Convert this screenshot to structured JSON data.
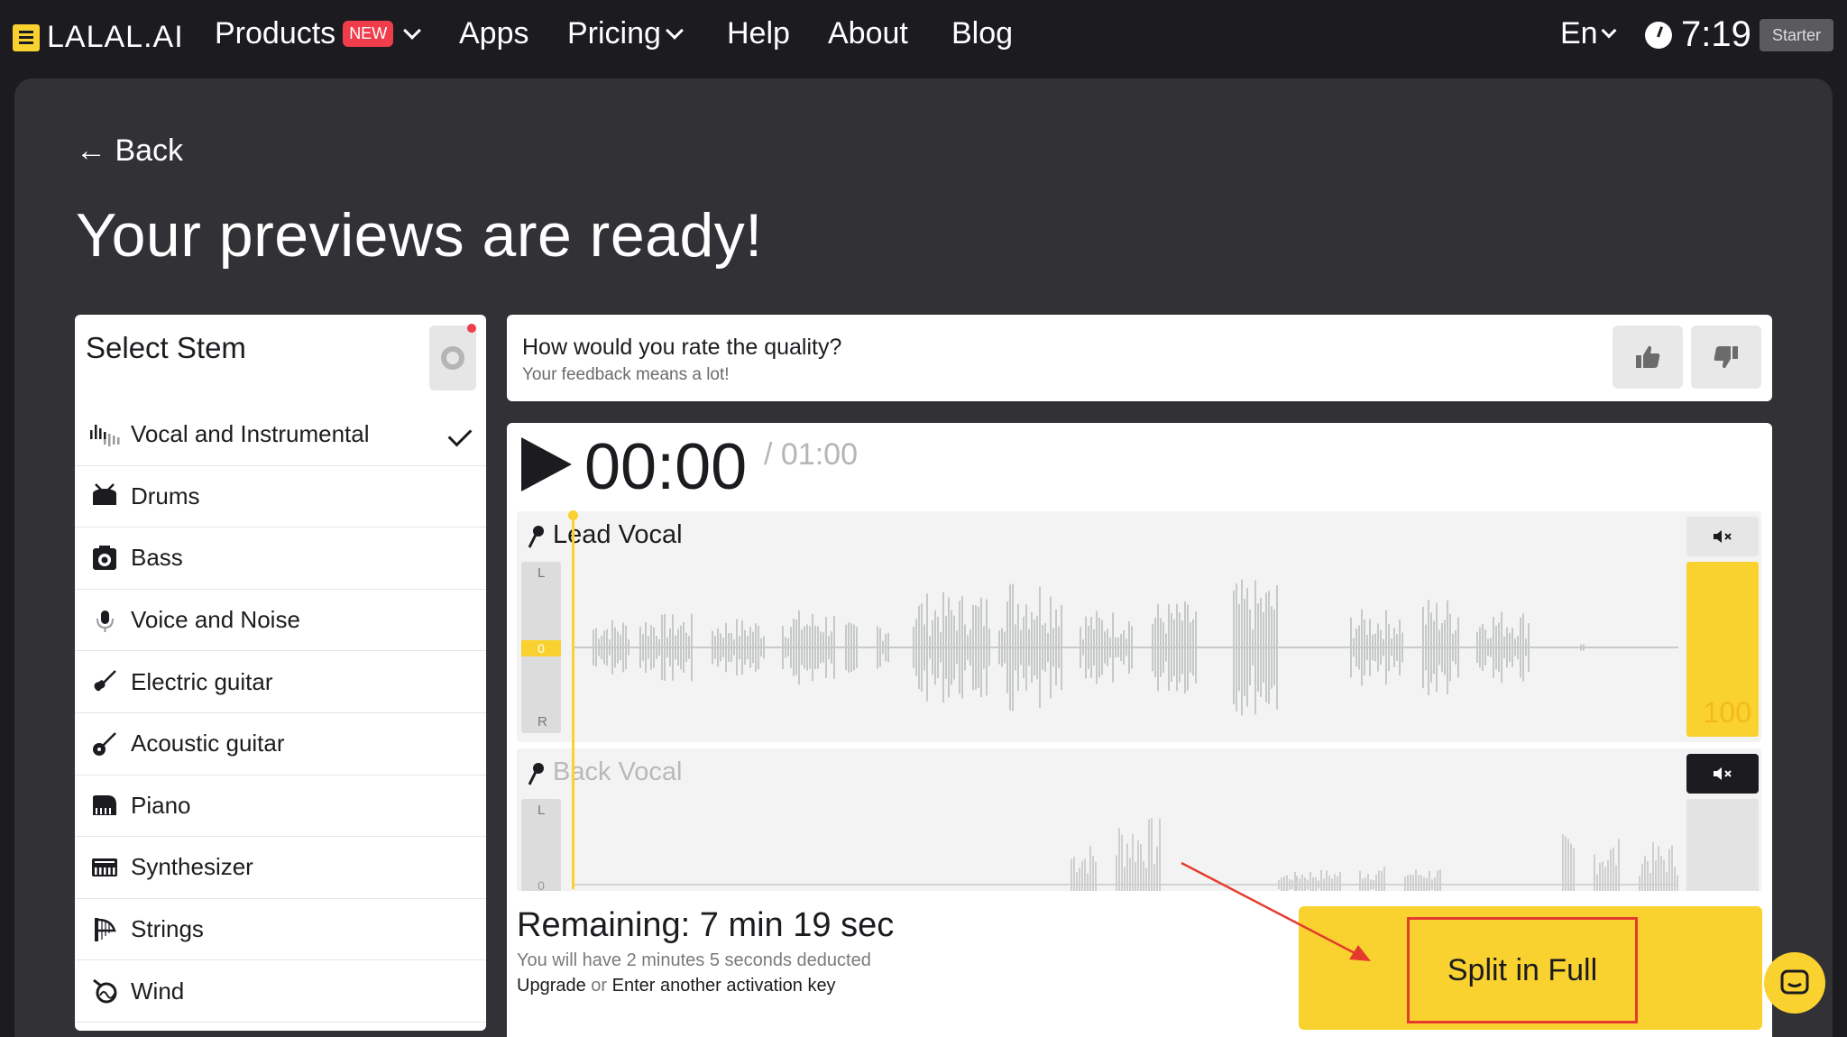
{
  "nav": {
    "logo": "LALAL.AI",
    "items": [
      {
        "label": "Products",
        "badge": "NEW"
      },
      {
        "label": "Apps"
      },
      {
        "label": "Pricing"
      },
      {
        "label": "Help"
      },
      {
        "label": "About"
      },
      {
        "label": "Blog"
      }
    ],
    "language": "En",
    "remaining_time": "7:19",
    "plan": "Starter"
  },
  "page": {
    "back_label": "← Back",
    "title": "Your previews are ready!"
  },
  "stems": {
    "title": "Select Stem",
    "items": [
      {
        "label": "Vocal and Instrumental",
        "icon": "waveform-icon",
        "selected": true
      },
      {
        "label": "Drums",
        "icon": "drum-icon"
      },
      {
        "label": "Bass",
        "icon": "bass-amp-icon"
      },
      {
        "label": "Voice and Noise",
        "icon": "microphone-icon"
      },
      {
        "label": "Electric guitar",
        "icon": "electric-guitar-icon"
      },
      {
        "label": "Acoustic guitar",
        "icon": "acoustic-guitar-icon"
      },
      {
        "label": "Piano",
        "icon": "piano-icon"
      },
      {
        "label": "Synthesizer",
        "icon": "synthesizer-icon"
      },
      {
        "label": "Strings",
        "icon": "harp-icon"
      },
      {
        "label": "Wind",
        "icon": "horn-icon"
      }
    ]
  },
  "feedback": {
    "question": "How would you rate the quality?",
    "subtitle": "Your feedback means a lot!"
  },
  "player": {
    "current_time": "00:00",
    "total_time": "/ 01:00",
    "tracks": [
      {
        "name": "Lead Vocal",
        "meter_l": "L",
        "meter_zero": "0",
        "meter_r": "R",
        "volume": "100",
        "muted": false
      },
      {
        "name": "Back Vocal",
        "meter_l": "L",
        "meter_zero": "0",
        "muted": true
      }
    ]
  },
  "summary": {
    "remaining": "Remaining: 7 min 19 sec",
    "deduct": "You will have 2 minutes 5 seconds deducted",
    "upgrade": "Upgrade",
    "or": "or",
    "activation": "Enter another activation key"
  },
  "split_label": "Split in Full",
  "colors": {
    "accent": "#f9d22f",
    "background": "#1c1b1f",
    "panel": "#323236",
    "badge": "#ef3d4b",
    "annotation": "#e53b2e"
  }
}
